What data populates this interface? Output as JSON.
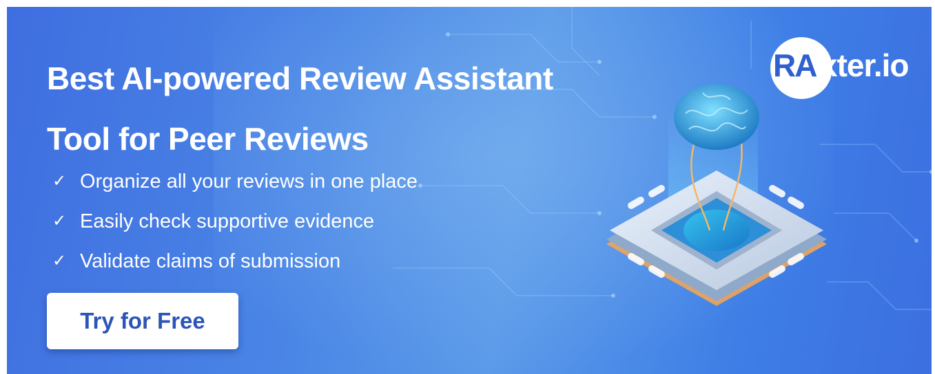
{
  "banner": {
    "headline_line1": "Best AI-powered Review Assistant",
    "headline_line2": "Tool for Peer Reviews",
    "features": [
      {
        "check": "✓",
        "text": "Organize all your reviews in one place"
      },
      {
        "check": "✓",
        "text": "Easily check supportive evidence"
      },
      {
        "check": "✓",
        "text": "Validate claims of submission"
      }
    ],
    "cta_label": "Try for Free"
  },
  "logo": {
    "mark_text": "RA",
    "rest_text": "xter.io"
  },
  "illustration": {
    "icon": "brain-on-chip-icon"
  },
  "colors": {
    "background_blue": "#4a86e6",
    "cta_text": "#2b55b8",
    "logo_mark": "#2f5fd1"
  }
}
